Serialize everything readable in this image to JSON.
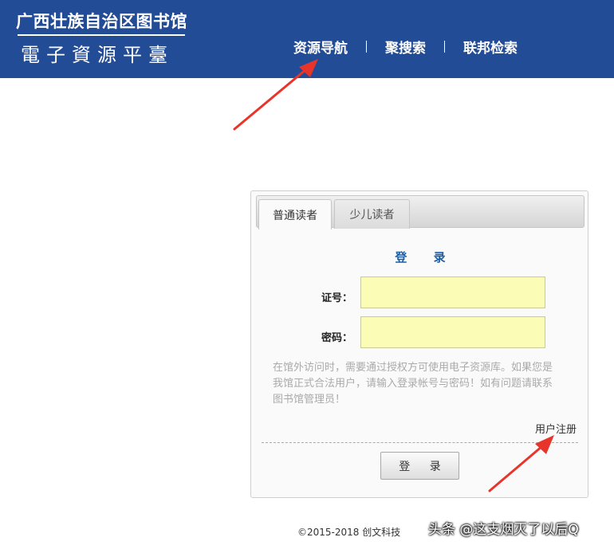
{
  "header": {
    "title": "广西壮族自治区图书馆",
    "subtitle": "電子資源平臺",
    "background_color": "#234c97",
    "nav": [
      {
        "label": "资源导航"
      },
      {
        "label": "聚搜索"
      },
      {
        "label": "联邦检索"
      }
    ]
  },
  "login_panel": {
    "tabs": [
      {
        "label": "普通读者",
        "active": true
      },
      {
        "label": "少儿读者",
        "active": false
      }
    ],
    "heading": "登 录",
    "fields": [
      {
        "label": "证号：",
        "value": "",
        "placeholder": ""
      },
      {
        "label": "密码：",
        "value": "",
        "placeholder": ""
      }
    ],
    "notice": "在馆外访问时，需要通过授权方可使用电子资源库。如果您是我馆正式合法用户，请输入登录帐号与密码！如有问题请联系图书馆管理员！",
    "register_link": "用户注册",
    "submit_label": "登 录",
    "input_background_color": "#fbfdb7",
    "heading_color": "#1f5fa5"
  },
  "annotations": {
    "arrow_color": "#e8352b"
  },
  "footer": {
    "copyright": "©2015-2018 创文科技",
    "watermark": "头条 @这支烟灭了以后Q"
  }
}
